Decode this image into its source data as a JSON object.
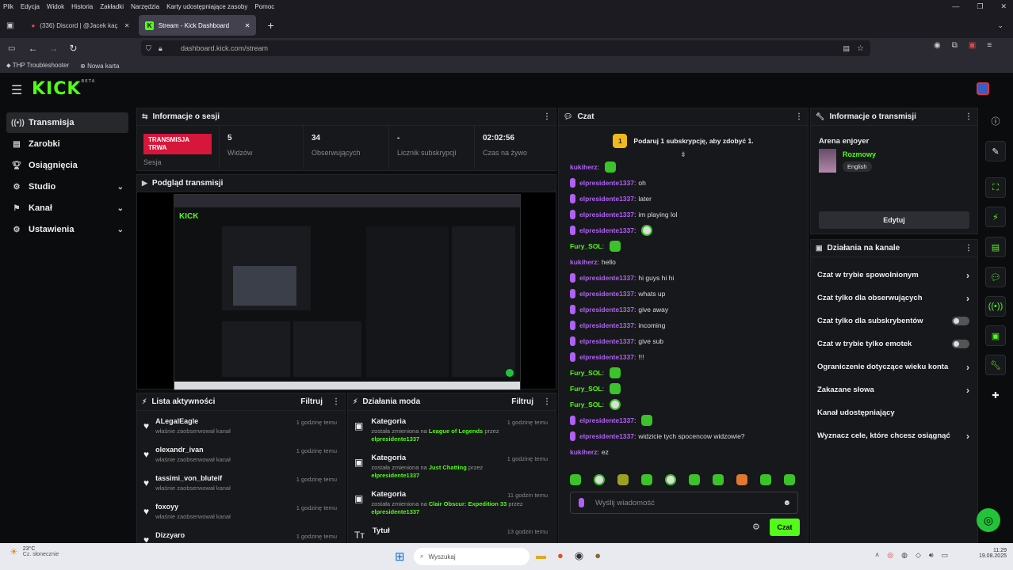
{
  "browser": {
    "menu": [
      "Plik",
      "Edycja",
      "Widok",
      "Historia",
      "Zakładki",
      "Narzędzia",
      "Karty udostępniające zasoby",
      "Pomoc"
    ],
    "tabs": [
      {
        "label": "(336) Discord | @Jacek kaç"
      },
      {
        "label": "Stream - Kick Dashboard"
      }
    ],
    "url_domain": "dashboard.kick.com/stream",
    "bookmarks": [
      "THP Troubleshooter",
      "Nowa karta"
    ]
  },
  "app": {
    "logo": "KICK",
    "logo_sup": "BETA"
  },
  "sidebar": {
    "items": [
      {
        "label": "Transmisja",
        "icon": "broadcast-icon",
        "active": true
      },
      {
        "label": "Zarobki",
        "icon": "wallet-icon"
      },
      {
        "label": "Osiągnięcia",
        "icon": "trophy-icon"
      },
      {
        "label": "Studio",
        "icon": "studio-icon",
        "expandable": true
      },
      {
        "label": "Kanał",
        "icon": "flag-icon",
        "expandable": true
      },
      {
        "label": "Ustawienia",
        "icon": "gear-icon",
        "expandable": true
      }
    ]
  },
  "session": {
    "title": "Informacje o sesji",
    "live_badge": "TRANSMISJA TRWA",
    "live_sub": "Sesja",
    "stats": [
      {
        "value": "5",
        "label": "Widzów"
      },
      {
        "value": "34",
        "label": "Obserwujących"
      },
      {
        "value": "-",
        "label": "Licznik subskrypcji"
      },
      {
        "value": "02:02:56",
        "label": "Czas na żywo"
      }
    ]
  },
  "preview": {
    "title": "Podgląd transmisji"
  },
  "activity": {
    "title": "Lista aktywności",
    "filter": "Filtruj",
    "items": [
      {
        "name": "ALegalEagle",
        "sub": "właśnie zaobserwował kanał",
        "time": "1 godzinę temu"
      },
      {
        "name": "olexandr_ivan",
        "sub": "właśnie zaobserwował kanał",
        "time": "1 godzinę temu"
      },
      {
        "name": "tassimi_von_bluteif",
        "sub": "właśnie zaobserwował kanał",
        "time": "1 godzinę temu"
      },
      {
        "name": "foxoyy",
        "sub": "właśnie zaobserwował kanał",
        "time": "1 godzinę temu"
      },
      {
        "name": "Dizzyaro",
        "sub": "",
        "time": "1 godzinę temu"
      }
    ]
  },
  "modactions": {
    "title": "Działania moda",
    "filter": "Filtruj",
    "items": [
      {
        "name": "Kategoria",
        "pre": "została zmieniona na ",
        "cat": "League of Legends",
        "mid": " przez",
        "user": "elpresidente1337",
        "time": "1 godzinę temu"
      },
      {
        "name": "Kategoria",
        "pre": "została zmieniona na ",
        "cat": "Just Chatting",
        "mid": " przez",
        "user": "elpresidente1337",
        "time": "1 godzinę temu"
      },
      {
        "name": "Kategoria",
        "pre": "została zmieniona na ",
        "cat": "Clair Obscur: Expedition 33",
        "mid": " przez",
        "user": "elpresidente1337",
        "time": "11 godzin temu"
      },
      {
        "name": "Tytuł",
        "pre": "",
        "cat": "",
        "mid": "",
        "user": "",
        "time": "13 godzin temu"
      }
    ]
  },
  "chat": {
    "title": "Czat",
    "banner": "Podaruj 1 subskrypcję, aby zdobyć 1.",
    "banner_badge": "1",
    "messages": [
      {
        "user": "kukiherz",
        "text": "",
        "color": "#b061f5",
        "badge": false,
        "emote": "green"
      },
      {
        "user": "elpresidente1337",
        "text": "oh",
        "color": "#b061f5",
        "badge": true
      },
      {
        "user": "elpresidente1337",
        "text": "later",
        "color": "#b061f5",
        "badge": true
      },
      {
        "user": "elpresidente1337",
        "text": "im playing lol",
        "color": "#b061f5",
        "badge": true
      },
      {
        "user": "elpresidente1337",
        "text": "",
        "color": "#b061f5",
        "badge": true,
        "emote": "face"
      },
      {
        "user": "Fury_SOL",
        "text": "",
        "color": "#53fc18",
        "badge": false,
        "emote": "green"
      },
      {
        "user": "kukiherz",
        "text": "hello",
        "color": "#b061f5",
        "badge": false
      },
      {
        "user": "elpresidente1337",
        "text": "hi guys hi hi",
        "color": "#b061f5",
        "badge": true
      },
      {
        "user": "elpresidente1337",
        "text": "whats up",
        "color": "#b061f5",
        "badge": true
      },
      {
        "user": "elpresidente1337",
        "text": "give away",
        "color": "#b061f5",
        "badge": true
      },
      {
        "user": "elpresidente1337",
        "text": "incoming",
        "color": "#b061f5",
        "badge": true
      },
      {
        "user": "elpresidente1337",
        "text": "give sub",
        "color": "#b061f5",
        "badge": true
      },
      {
        "user": "elpresidente1337",
        "text": "!!!",
        "color": "#b061f5",
        "badge": true
      },
      {
        "user": "Fury_SOL",
        "text": "",
        "color": "#53fc18",
        "badge": false,
        "emote": "green"
      },
      {
        "user": "Fury_SOL",
        "text": "",
        "color": "#53fc18",
        "badge": false,
        "emote": "green"
      },
      {
        "user": "Fury_SOL",
        "text": "",
        "color": "#53fc18",
        "badge": false,
        "emote": "face"
      },
      {
        "user": "elpresidente1337",
        "text": "",
        "color": "#b061f5",
        "badge": true,
        "emote": "green"
      },
      {
        "user": "elpresidente1337",
        "text": "widzicie tych spocencow widzowie?",
        "color": "#b061f5",
        "badge": true
      },
      {
        "user": "kukiherz",
        "text": "ez",
        "color": "#b061f5",
        "badge": false
      }
    ],
    "input_placeholder": "Wyślij wiadomość",
    "send_label": "Czat"
  },
  "stream_info": {
    "title": "Informacje o transmisji",
    "stream_title": "Arena enjoyer",
    "category": "Rozmowy",
    "language": "English",
    "edit_label": "Edytuj"
  },
  "channel_actions": {
    "title": "Działania na kanale",
    "rows": [
      {
        "label": "Czat w trybie spowolnionym",
        "kind": "chevron"
      },
      {
        "label": "Czat tylko dla obserwujących",
        "kind": "chevron"
      },
      {
        "label": "Czat tylko dla subskrybentów",
        "kind": "toggle"
      },
      {
        "label": "Czat w trybie tylko emotek",
        "kind": "toggle"
      },
      {
        "label": "Ograniczenie dotyczące wieku konta",
        "kind": "chevron"
      },
      {
        "label": "Zakazane słowa",
        "kind": "chevron"
      },
      {
        "label": "Kanał udostępniający",
        "kind": "none"
      },
      {
        "label": "Wyznacz cele, które chcesz osiągnąć",
        "kind": "chevron"
      }
    ]
  },
  "taskbar": {
    "weather_temp": "23°C",
    "weather_desc": "Cz. słonecznie",
    "search": "Wyszukaj",
    "time": "11:29",
    "date": "19.08.2025"
  },
  "colors": {
    "accent": "#53fc18",
    "live": "#d6163b",
    "panel": "#17181b",
    "purple": "#b061f5"
  }
}
